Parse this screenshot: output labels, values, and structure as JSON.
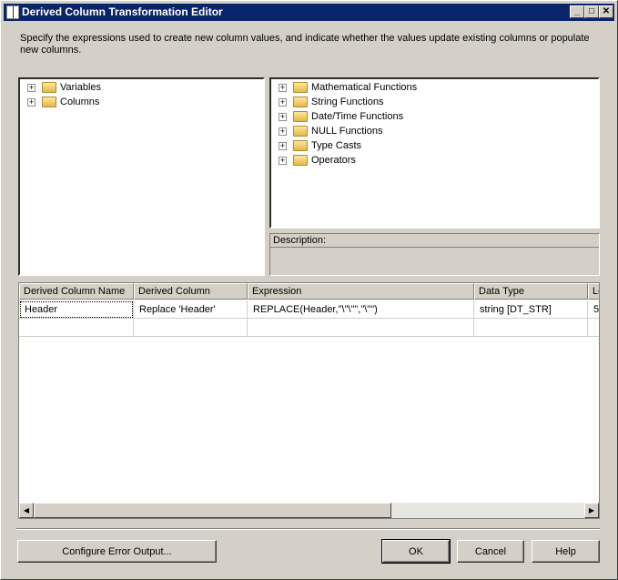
{
  "window": {
    "title": "Derived Column Transformation Editor",
    "minimize": "_",
    "maximize": "□",
    "close": "✕"
  },
  "description_text": "Specify the expressions used to create new column values, and indicate whether the values update existing columns or populate new columns.",
  "left_tree": [
    {
      "label": "Variables"
    },
    {
      "label": "Columns"
    }
  ],
  "right_tree": [
    {
      "label": "Mathematical Functions"
    },
    {
      "label": "String Functions"
    },
    {
      "label": "Date/Time Functions"
    },
    {
      "label": "NULL Functions"
    },
    {
      "label": "Type Casts"
    },
    {
      "label": "Operators"
    }
  ],
  "description_label": "Description:",
  "grid": {
    "headers": [
      "Derived Column Name",
      "Derived Column",
      "Expression",
      "Data Type",
      "Le"
    ],
    "rows": [
      [
        "Header",
        "Replace 'Header'",
        "REPLACE(Header,\"\\\"\\\"\",\"\\\"\")",
        "string [DT_STR]",
        "5"
      ]
    ]
  },
  "buttons": {
    "configure": "Configure Error Output...",
    "ok": "OK",
    "cancel": "Cancel",
    "help": "Help"
  }
}
